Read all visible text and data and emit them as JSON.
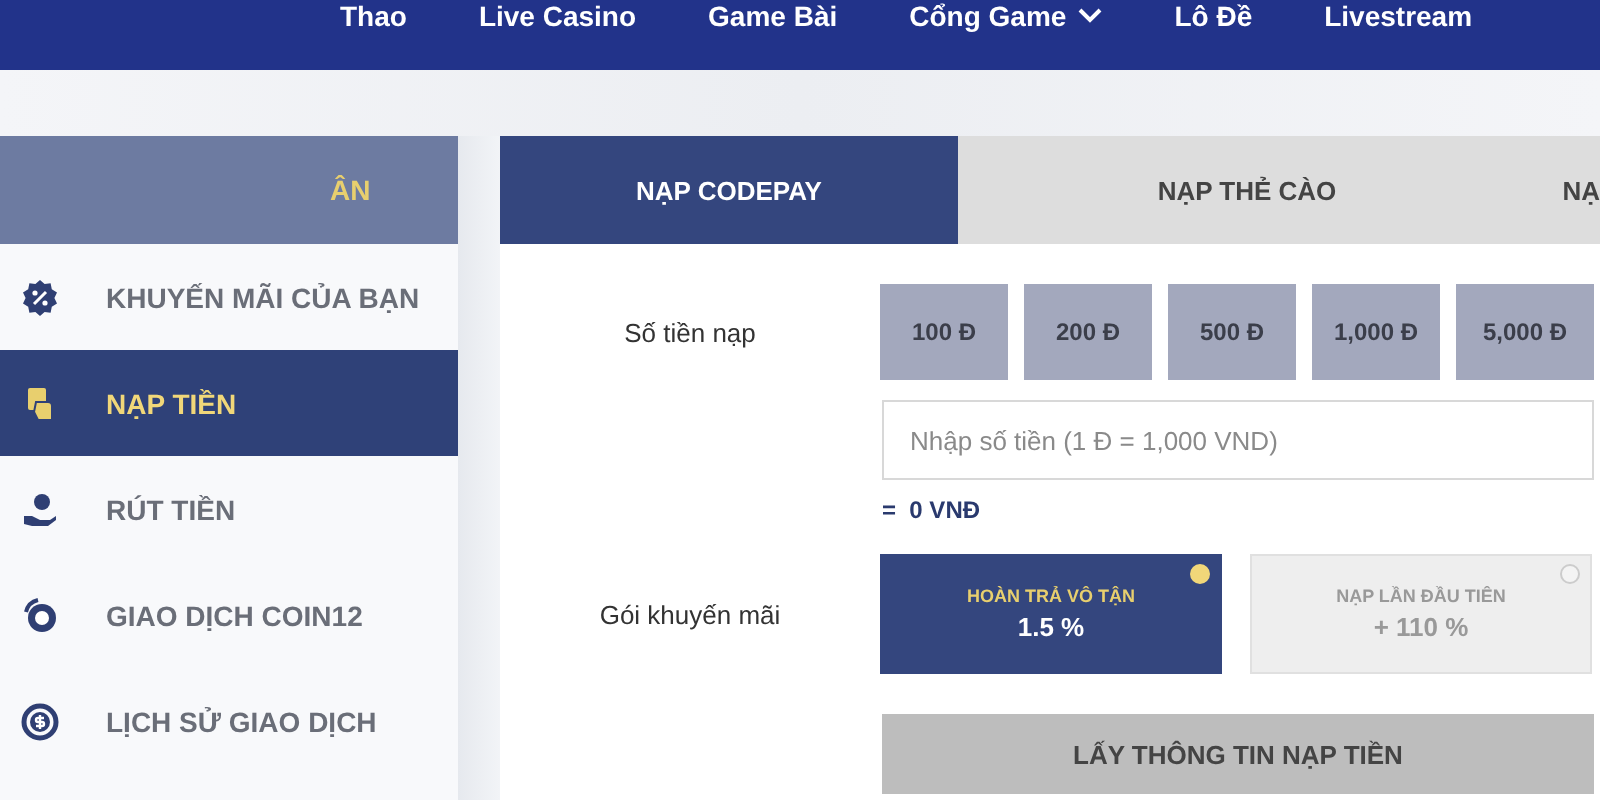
{
  "nav": {
    "items": [
      {
        "label": "Thao",
        "dropdown": false
      },
      {
        "label": "Live Casino",
        "dropdown": false
      },
      {
        "label": "Game Bài",
        "dropdown": false
      },
      {
        "label": "Cổng Game",
        "dropdown": true
      },
      {
        "label": "Lô Đề",
        "dropdown": false
      },
      {
        "label": "Livestream",
        "dropdown": false
      }
    ]
  },
  "sidebar": {
    "header": "ÂN",
    "items": [
      {
        "label": "KHUYẾN MÃI CỦA BẠN",
        "kind": "promo",
        "selected": false
      },
      {
        "label": "NẠP TIỀN",
        "kind": "deposit",
        "selected": true
      },
      {
        "label": "RÚT TIỀN",
        "kind": "withdraw",
        "selected": false
      },
      {
        "label": "GIAO DỊCH COIN12",
        "kind": "coin",
        "selected": false
      },
      {
        "label": "LỊCH SỬ GIAO DỊCH",
        "kind": "history",
        "selected": false
      }
    ]
  },
  "tabs": [
    {
      "label": "NẠP CODEPAY",
      "selected": true
    },
    {
      "label": "NẠP THẺ CÀO",
      "selected": false
    },
    {
      "label": "NẠ",
      "selected": false
    }
  ],
  "form": {
    "amount_label": "Số tiền nạp",
    "amounts": [
      "100 Đ",
      "200 Đ",
      "500 Đ",
      "1,000 Đ",
      "5,000 Đ"
    ],
    "amount_field": {
      "placeholder": "Nhập số tiền (1 Đ = 1,000 VND)"
    },
    "converted": "=  0 VNĐ",
    "promo_label": "Gói khuyến mãi",
    "promos": [
      {
        "title": "HOÀN TRẢ VÔ TẬN",
        "value": "1.5 %",
        "selected": true
      },
      {
        "title": "NẠP LẦN ĐẦU TIÊN",
        "value": "+ 110 %",
        "selected": false
      }
    ],
    "submit": "LẤY THÔNG TIN NẠP TIỀN"
  }
}
